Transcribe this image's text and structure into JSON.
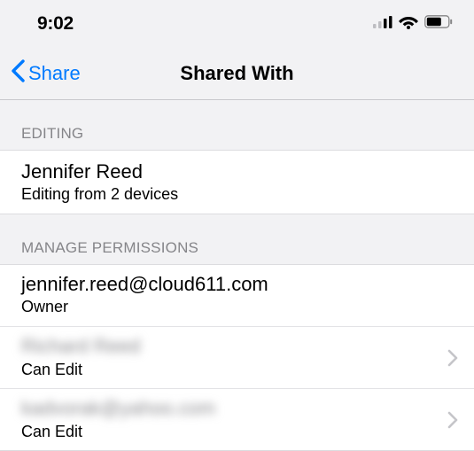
{
  "status_bar": {
    "time": "9:02"
  },
  "nav": {
    "back_label": "Share",
    "title": "Shared With"
  },
  "sections": {
    "editing": {
      "header": "EDITING",
      "name": "Jennifer Reed",
      "detail": "Editing from 2 devices"
    },
    "permissions": {
      "header": "MANAGE PERMISSIONS",
      "people": [
        {
          "name": "jennifer.reed@cloud611.com",
          "role": "Owner",
          "blurred": false,
          "chevron": false
        },
        {
          "name": "Richard Reed",
          "role": "Can Edit",
          "blurred": true,
          "chevron": true
        },
        {
          "name": "kadvorak@yahoo.com",
          "role": "Can Edit",
          "blurred": true,
          "chevron": true
        }
      ]
    }
  }
}
